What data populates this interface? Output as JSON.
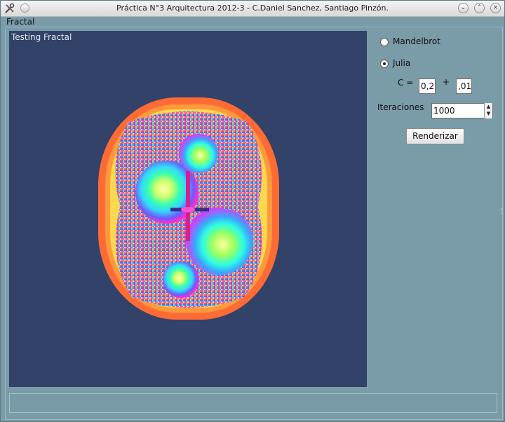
{
  "window": {
    "title": "Práctica N°3 Arquitectura 2012-3 - C.Daniel Sanchez, Santiago Pinzón.",
    "icons": {
      "app": "tools-icon",
      "menu": "window-menu-dot-icon",
      "minimize": "minimize-icon",
      "maximize": "maximize-icon",
      "close": "close-icon"
    }
  },
  "menubar": {
    "menu_label": "Fractal"
  },
  "canvas": {
    "label": "Testing Fractal",
    "background": "#324268"
  },
  "controls": {
    "fractal_options": [
      {
        "label": "Mandelbrot",
        "checked": false
      },
      {
        "label": "Julia",
        "checked": true
      }
    ],
    "c_label": "C =",
    "c_real": "0,2",
    "plus": "+",
    "c_imag": ",01",
    "iterations_label": "Iteraciones",
    "iterations_value": "1000",
    "render_button": "Renderizar"
  },
  "colors": {
    "window_bg": "#7a9ba8",
    "canvas_bg": "#324268",
    "fractal_outer": "#ff6b35"
  }
}
